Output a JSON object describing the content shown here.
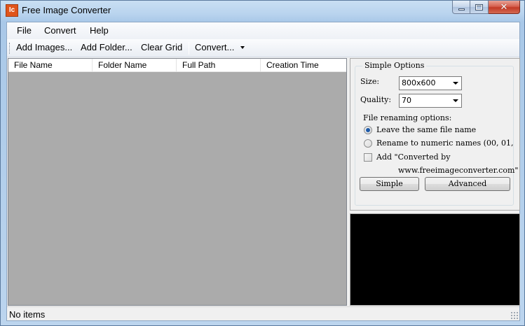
{
  "window": {
    "title": "Free Image Converter",
    "app_icon_text": "Ic"
  },
  "menu": {
    "items": [
      {
        "label": "File"
      },
      {
        "label": "Convert"
      },
      {
        "label": "Help"
      }
    ]
  },
  "toolbar": {
    "add_images_label": "Add Images...",
    "add_folder_label": "Add Folder...",
    "clear_grid_label": "Clear Grid",
    "convert_label": "Convert..."
  },
  "grid": {
    "columns": [
      {
        "label": "File Name"
      },
      {
        "label": "Folder Name"
      },
      {
        "label": "Full Path"
      },
      {
        "label": "Creation Time"
      }
    ],
    "rows": []
  },
  "options": {
    "group_title": "Simple Options",
    "size_label": "Size:",
    "size_value": "800x600",
    "quality_label": "Quality:",
    "quality_value": "70",
    "renaming_label": "File renaming options:",
    "radio_leave": "Leave the same file name",
    "radio_rename": "Rename to numeric names (00, 01, .",
    "radio_selected": "Leave the same file name",
    "checkbox_line1": "Add \"Converted by",
    "checkbox_line2": "www.freeimageconverter.com\"",
    "checkbox_checked": false,
    "simple_button": "Simple",
    "advanced_button": "Advanced"
  },
  "status": {
    "text": "No items"
  },
  "colors": {
    "grid_background": "#ababab",
    "preview_background": "#000000",
    "app_icon": "#e0541b",
    "close_button": "#c23a26"
  }
}
